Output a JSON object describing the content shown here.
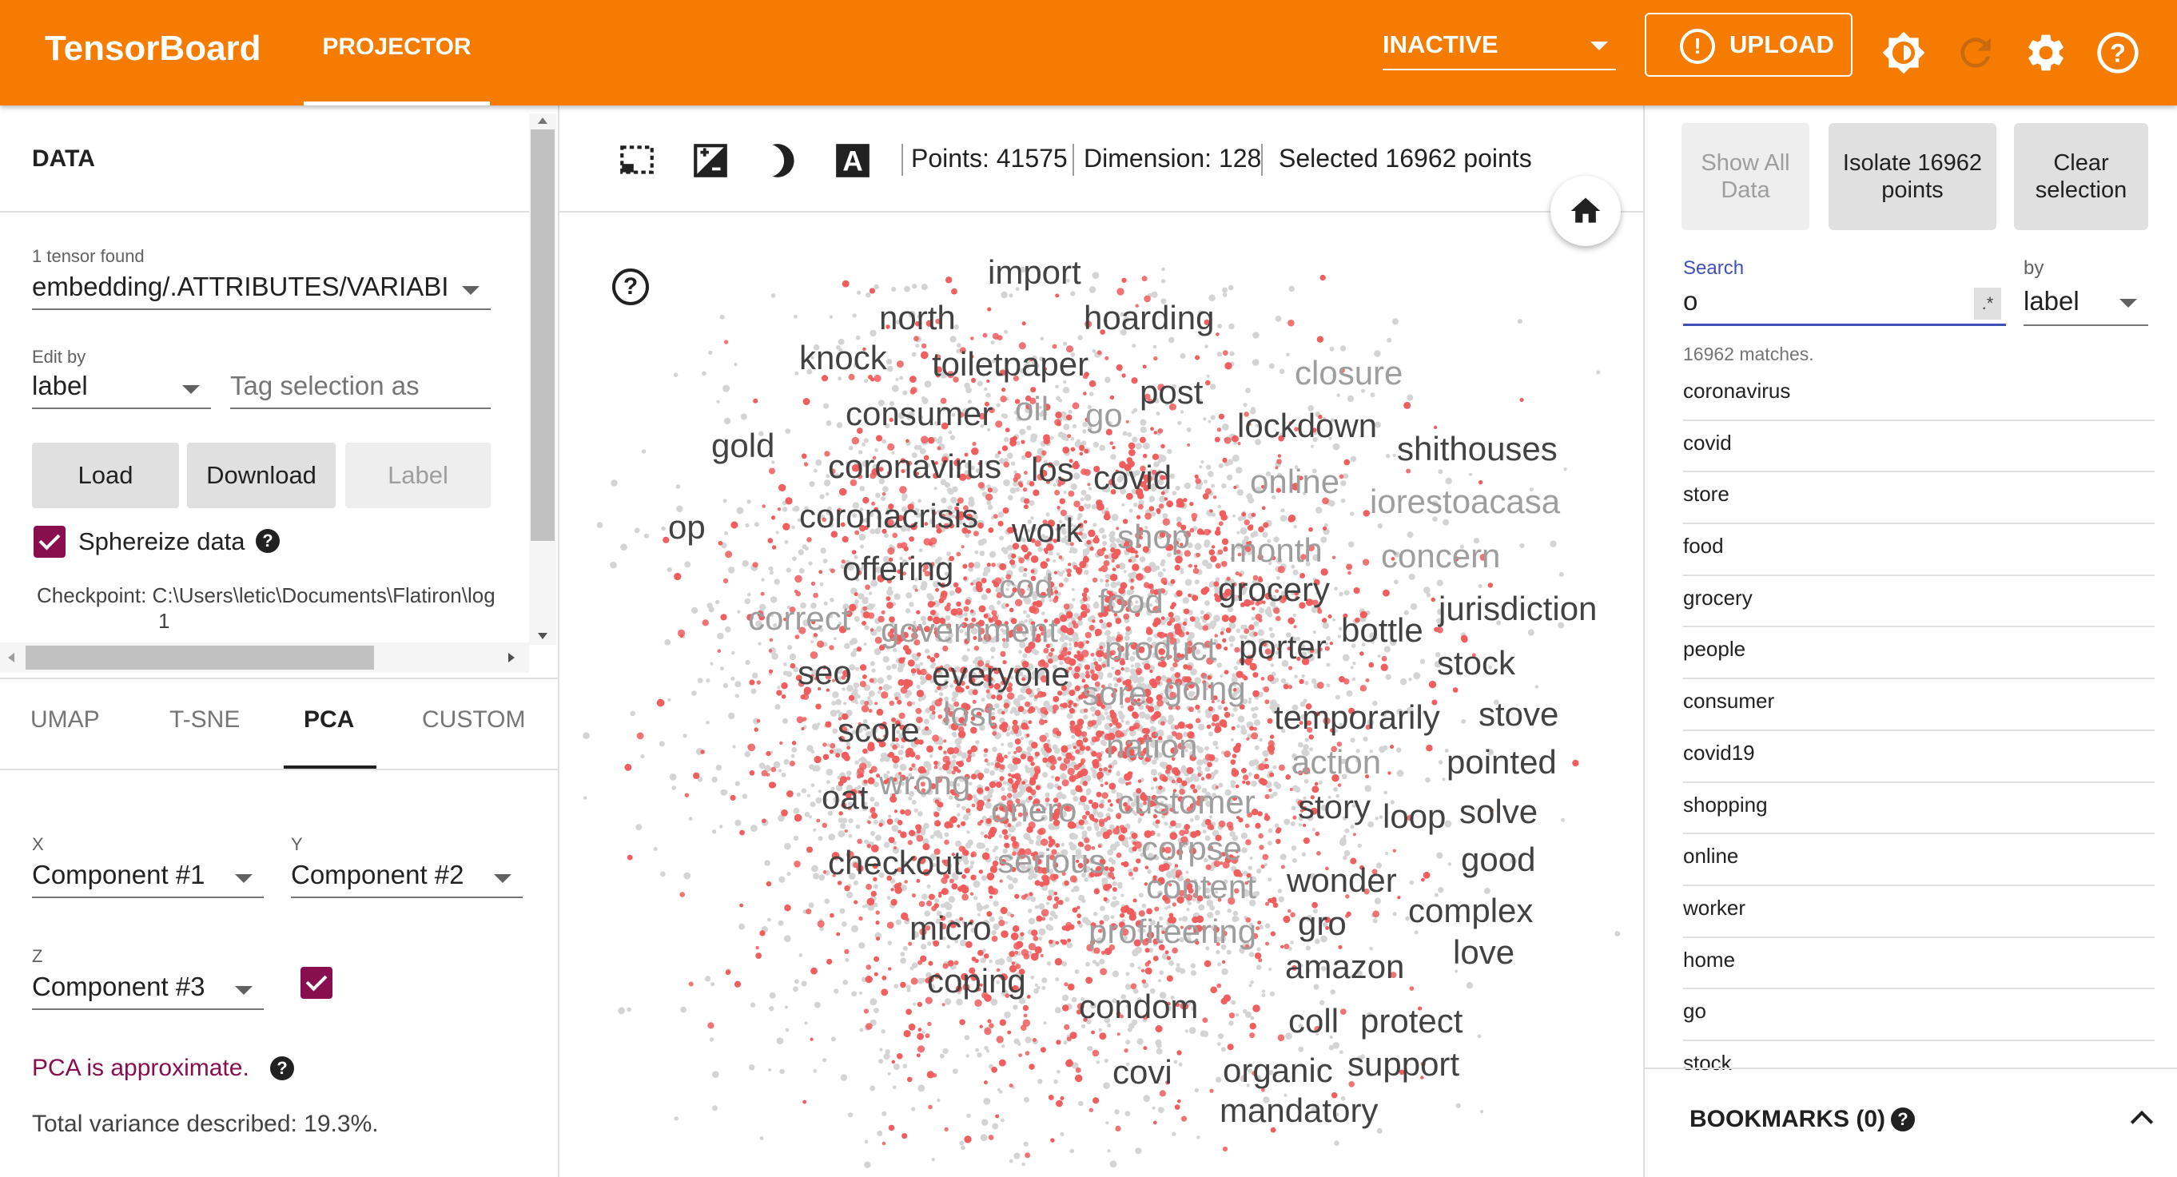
{
  "header": {
    "brand": "TensorBoard",
    "tab": "PROJECTOR",
    "run_selector": "INACTIVE",
    "upload_label": "UPLOAD",
    "accent": "#f57c00"
  },
  "left": {
    "section_title": "DATA",
    "tensor_found": "1 tensor found",
    "tensor_name": "embedding/.ATTRIBUTES/VARIABI",
    "edit_by_label": "Edit by",
    "edit_by_value": "label",
    "tag_placeholder": "Tag selection as",
    "buttons": {
      "load": "Load",
      "download": "Download",
      "label": "Label"
    },
    "sphereize_label": "Sphereize data",
    "checkpoint_label": "Checkpoint:",
    "checkpoint_path": "C:\\Users\\letic\\Documents\\Flatiron\\log",
    "checkpoint_line2": "1",
    "proj_tabs": [
      "UMAP",
      "T-SNE",
      "PCA",
      "CUSTOM"
    ],
    "active_tab": "PCA",
    "x_label": "X",
    "x_value": "Component #1",
    "y_label": "Y",
    "y_value": "Component #2",
    "z_label": "Z",
    "z_value": "Component #3",
    "pca_note": "PCA is approximate.",
    "variance": "Total variance described: 19.3%."
  },
  "center": {
    "points": "Points: 41575",
    "dimension": "Dimension: 128",
    "selected": "Selected 16962 points",
    "icons": [
      "selection-box-icon",
      "night-mode-icon",
      "label-toggle-icon",
      "home-icon",
      "help-icon"
    ],
    "dark_labels": [
      [
        "import",
        1236,
        355
      ],
      [
        "north",
        1100,
        412
      ],
      [
        "hoarding",
        1356,
        412
      ],
      [
        "knock",
        1000,
        462
      ],
      [
        "toiletpaper",
        1166,
        470
      ],
      [
        "consumer",
        1058,
        532
      ],
      [
        "post",
        1426,
        505
      ],
      [
        "lockdown",
        1548,
        547
      ],
      [
        "shithouses",
        1748,
        576
      ],
      [
        "gold",
        890,
        572
      ],
      [
        "coronavirus",
        1036,
        598
      ],
      [
        "los",
        1290,
        602
      ],
      [
        "covid",
        1368,
        612
      ],
      [
        "op",
        836,
        674
      ],
      [
        "coronacrisis",
        1000,
        660
      ],
      [
        "work",
        1266,
        678
      ],
      [
        "offering",
        1054,
        726
      ],
      [
        "jurisdiction",
        1800,
        776
      ],
      [
        "grocery",
        1524,
        752
      ],
      [
        "bottle",
        1678,
        803
      ],
      [
        "porter",
        1550,
        824
      ],
      [
        "stock",
        1798,
        844
      ],
      [
        "seo",
        998,
        856
      ],
      [
        "everyone",
        1166,
        858
      ],
      [
        "score",
        1048,
        928
      ],
      [
        "temporarily",
        1594,
        912
      ],
      [
        "stove",
        1850,
        908
      ],
      [
        "pointed",
        1810,
        968
      ],
      [
        "oat",
        1028,
        1012
      ],
      [
        "story",
        1624,
        1024
      ],
      [
        "loop",
        1730,
        1036
      ],
      [
        "solve",
        1826,
        1030
      ],
      [
        "checkout",
        1036,
        1094
      ],
      [
        "good",
        1828,
        1090
      ],
      [
        "wonder",
        1610,
        1116
      ],
      [
        "complex",
        1762,
        1154
      ],
      [
        "micro",
        1138,
        1176
      ],
      [
        "gro",
        1624,
        1170
      ],
      [
        "love",
        1818,
        1206
      ],
      [
        "coping",
        1160,
        1242
      ],
      [
        "amazon",
        1608,
        1224
      ],
      [
        "condom",
        1350,
        1274
      ],
      [
        "coll",
        1612,
        1292
      ],
      [
        "protect",
        1702,
        1292
      ],
      [
        "covi",
        1392,
        1356
      ],
      [
        "support",
        1686,
        1346
      ],
      [
        "organic",
        1530,
        1354
      ],
      [
        "mandatory",
        1526,
        1404
      ]
    ],
    "gray_labels": [
      [
        "closure",
        1620,
        481
      ],
      [
        "oil",
        1270,
        526
      ],
      [
        "go",
        1358,
        534
      ],
      [
        "online",
        1564,
        617
      ],
      [
        "iorestoacasa",
        1714,
        642
      ],
      [
        "shop",
        1398,
        686
      ],
      [
        "month",
        1538,
        703
      ],
      [
        "concern",
        1728,
        710
      ],
      [
        "cod",
        1250,
        748
      ],
      [
        "food",
        1374,
        767
      ],
      [
        "correct",
        936,
        788
      ],
      [
        "government",
        1102,
        803
      ],
      [
        "product",
        1382,
        826
      ],
      [
        "sore",
        1354,
        882
      ],
      [
        "going",
        1456,
        876
      ],
      [
        "lost",
        1180,
        908
      ],
      [
        "nation",
        1384,
        948
      ],
      [
        "action",
        1616,
        968
      ],
      [
        "wrong",
        1100,
        994
      ],
      [
        "onero",
        1240,
        1028
      ],
      [
        "customer",
        1398,
        1018
      ],
      [
        "serious",
        1248,
        1092
      ],
      [
        "corpse",
        1428,
        1076
      ],
      [
        "content",
        1434,
        1124
      ],
      [
        "profiteering",
        1362,
        1180
      ]
    ]
  },
  "right": {
    "show_all": "Show All Data",
    "isolate": "Isolate 16962 points",
    "clear": "Clear selection",
    "search_label": "Search",
    "search_value": "o",
    "regex": ".*",
    "by_label": "by",
    "by_value": "label",
    "matches": "16962 matches.",
    "results": [
      "coronavirus",
      "covid",
      "store",
      "food",
      "grocery",
      "people",
      "consumer",
      "covid19",
      "shopping",
      "online",
      "worker",
      "home",
      "go",
      "stock"
    ],
    "bookmarks": "BOOKMARKS (0)"
  }
}
